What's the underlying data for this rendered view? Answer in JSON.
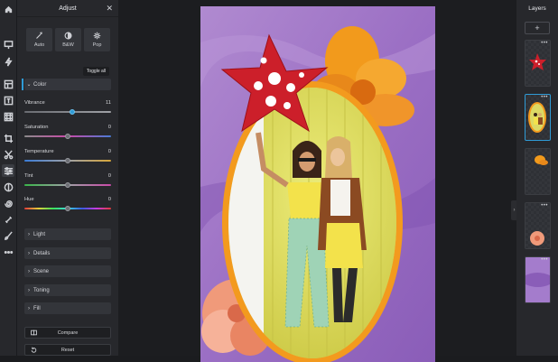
{
  "panel": {
    "title": "Adjust",
    "auto_buttons": [
      {
        "label": "Auto",
        "icon": "magic-wand-icon"
      },
      {
        "label": "B&W",
        "icon": "half-circle-icon"
      },
      {
        "label": "Pop",
        "icon": "sparkle-icon"
      }
    ],
    "toggle_all": "Toggle all",
    "color_section": "Color",
    "sliders": [
      {
        "label": "Vibrance",
        "value": "11",
        "fraction": 0.55
      },
      {
        "label": "Saturation",
        "value": "0",
        "fraction": 0.5
      },
      {
        "label": "Temperature",
        "value": "0",
        "fraction": 0.5
      },
      {
        "label": "Tint",
        "value": "0",
        "fraction": 0.5
      },
      {
        "label": "Hue",
        "value": "0",
        "fraction": 0.5
      }
    ],
    "sections": [
      "Light",
      "Details",
      "Scene",
      "Toning",
      "Fill"
    ],
    "compare": "Compare",
    "reset": "Reset"
  },
  "layers": {
    "title": "Layers",
    "add": "+",
    "menu": "•••"
  },
  "colors": {
    "accent": "#2f9bd6",
    "panel_bg": "#27282c",
    "canvas_bg": "#1c1d20"
  }
}
